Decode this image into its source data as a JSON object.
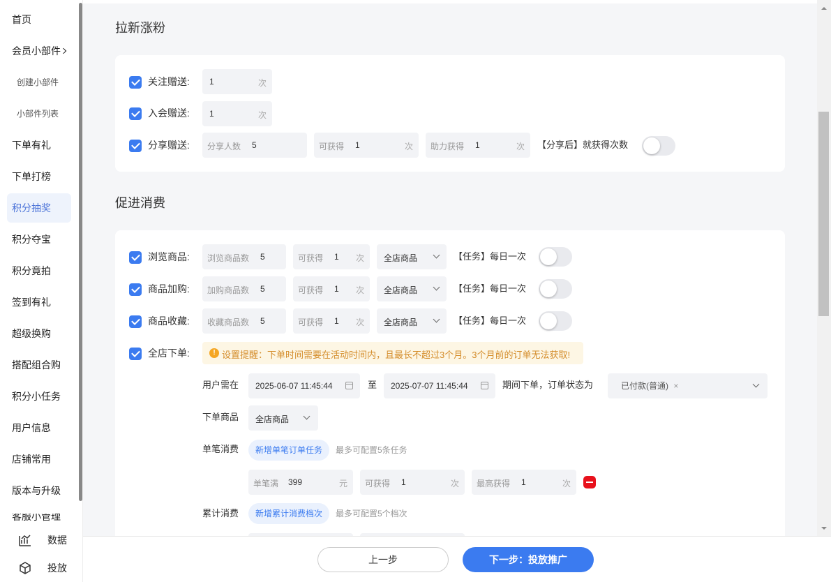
{
  "sidebar": {
    "items": [
      "首页",
      "会员小部件",
      "创建小部件",
      "小部件列表",
      "下单有礼",
      "下单打榜",
      "积分抽奖",
      "积分夺宝",
      "积分竟拍",
      "签到有礼",
      "超级换购",
      "搭配组合购",
      "积分小任务",
      "用户信息",
      "店铺常用",
      "版本与升级"
    ],
    "partial": "客服小管理",
    "bottom": [
      "数据",
      "投放"
    ]
  },
  "section1": {
    "title": "拉新涨粉",
    "follow": {
      "label": "关注赠送:",
      "value": "1",
      "unit": "次"
    },
    "join": {
      "label": "入会赠送:",
      "value": "1",
      "unit": "次"
    },
    "share": {
      "label": "分享赠送:",
      "people_ph": "分享人数",
      "people_val": "5",
      "get_ph": "可获得",
      "get_val": "1",
      "get_unit": "次",
      "assist_ph": "助力获得",
      "assist_val": "1",
      "assist_unit": "次",
      "after_text": "【分享后】就获得次数"
    }
  },
  "section2": {
    "title": "促进消费",
    "rows": [
      {
        "label": "浏览商品:",
        "ph": "浏览商品数",
        "val": "5",
        "get_ph": "可获得",
        "get_val": "1",
        "unit": "次",
        "scope": "全店商品",
        "task": "【任务】每日一次"
      },
      {
        "label": "商品加购:",
        "ph": "加购商品数",
        "val": "5",
        "get_ph": "可获得",
        "get_val": "1",
        "unit": "次",
        "scope": "全店商品",
        "task": "【任务】每日一次"
      },
      {
        "label": "商品收藏:",
        "ph": "收藏商品数",
        "val": "5",
        "get_ph": "可获得",
        "get_val": "1",
        "unit": "次",
        "scope": "全店商品",
        "task": "【任务】每日一次"
      }
    ],
    "order": {
      "label": "全店下单:",
      "warning": "设置提醒：下单时间需要在活动时间内，且最长不超过3个月。3个月前的订单无法获取!",
      "need_label": "用户需在",
      "start": "2025-06-07 11:45:44",
      "to": "至",
      "end": "2025-07-07 11:45:44",
      "status_text": "期间下单，订单状态为",
      "status_tag": "已付款(普通)",
      "goods_label": "下单商品",
      "goods_val": "全店商品",
      "single_label": "单笔消费",
      "single_btn": "新增单笔订单任务",
      "single_hint": "最多可配置5条任务",
      "single_row": {
        "amount_ph": "单笔满",
        "amount_val": "399",
        "amount_unit": "元",
        "get_ph": "可获得",
        "get_val": "1",
        "get_unit": "次",
        "max_ph": "最高获得",
        "max_val": "1",
        "max_unit": "次"
      },
      "cum_label": "累计消费",
      "cum_btn": "新增累计消费档次",
      "cum_hint": "最多可配置5个档次"
    }
  },
  "footer": {
    "prev": "上一步",
    "next": "下一步：投放推广"
  },
  "colors": {
    "accent": "#3b7bf0",
    "danger": "#e8111c",
    "warning_bg": "#fdf6e4"
  }
}
